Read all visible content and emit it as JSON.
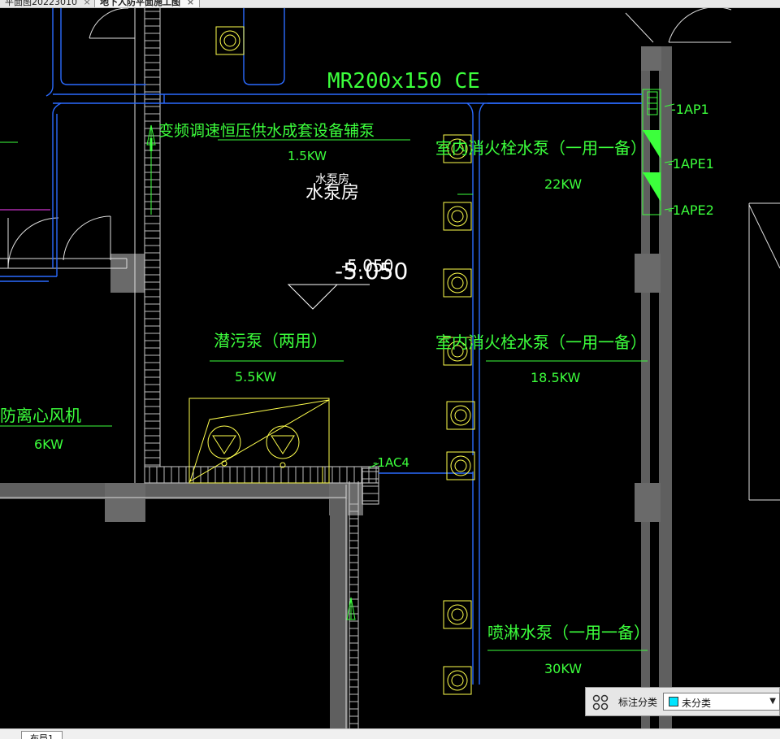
{
  "tabs": [
    {
      "label": "平面图20223010",
      "close": "×"
    },
    {
      "label": "地下人防平面施工图",
      "close": "×"
    }
  ],
  "drawing": {
    "duct_label": "MR200x150 CE",
    "pump_room": "水泵房",
    "pump_room_overlap": "水泵房",
    "elevation": "-5.050",
    "elevation_overlap": "-5.050",
    "aux_pump": {
      "name": "变频调速恒压供水成套设备辅泵",
      "power": "1.5KW"
    },
    "sewage_pump": {
      "name": "潜污泵（两用）",
      "power": "5.5KW"
    },
    "hydrant_pump_1": {
      "name": "室内消火栓水泵（一用一备）",
      "power": "22KW"
    },
    "hydrant_pump_2": {
      "name": "室内消火栓水泵（一用一备）",
      "power": "18.5KW"
    },
    "sprinkler_pump": {
      "name": "喷淋水泵（一用一备）",
      "power": "30KW"
    },
    "fan": {
      "name": "消防离心风机",
      "power": "6KW"
    },
    "panel_tags": [
      "-1AP1",
      "-1APE1",
      "-1APE2"
    ],
    "circuit_tag": "-1AC4"
  },
  "annotation": {
    "label": "标注分类",
    "selected": "未分类",
    "swatch_color": "#00e5ff"
  },
  "layout_tab": "布局1",
  "colors": {
    "background": "#000000",
    "text": "#3cff3c",
    "conduit": "#1e5cff",
    "wall": "#5f5f5f",
    "equipment": "#ffff4d"
  }
}
